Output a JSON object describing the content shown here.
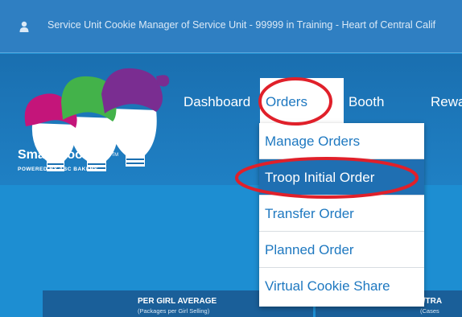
{
  "top_bar": {
    "user_context": "Service Unit Cookie Manager of Service Unit - 99999 in Training - Heart of Central Calif"
  },
  "logo": {
    "brand": "Smart Cookies",
    "tm": "TM",
    "tagline": "POWERED BY ABC BAKERS"
  },
  "nav": {
    "dashboard": "Dashboard",
    "orders": "Orders",
    "booth": "Booth",
    "rewards": "Rewa"
  },
  "orders_menu": {
    "items": [
      "Manage Orders",
      "Troop Initial Order",
      "Transfer Order",
      "Planned Order",
      "Virtual Cookie Share"
    ],
    "active_index": 1
  },
  "stats": {
    "card1_title": "PER GIRL AVERAGE",
    "card1_sub": "(Packages per Girl Selling)",
    "card2_title": "INITIAL ORDER/TRA",
    "card2_sub": "(Cases"
  },
  "colors": {
    "annotation_red": "#e0202a",
    "link_blue": "#1e78c0",
    "active_bg": "#1f6fb2"
  }
}
